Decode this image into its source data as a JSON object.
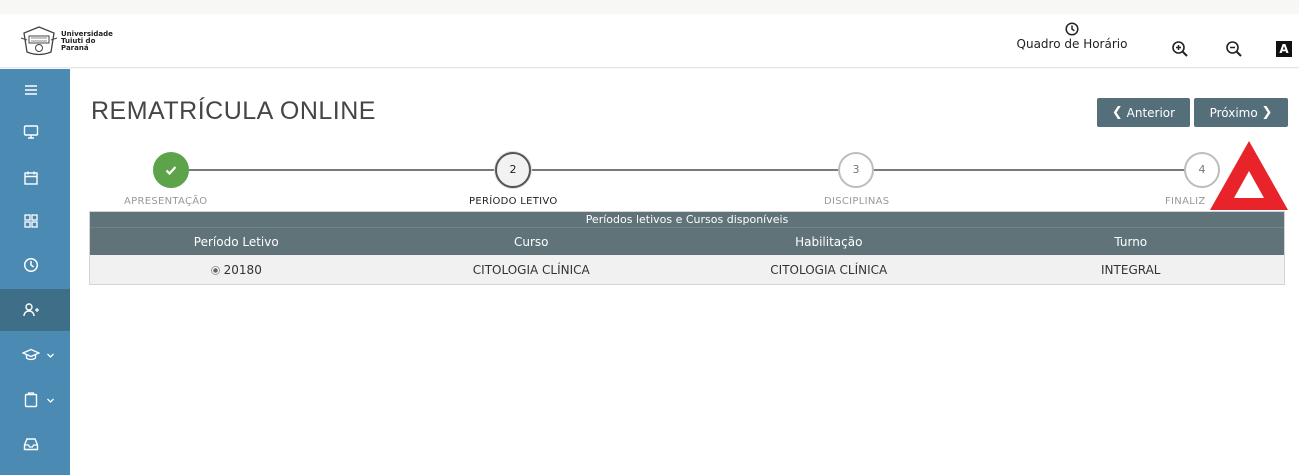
{
  "header": {
    "logo_text": [
      "Universidade",
      "Tuiuti do",
      "Paraná"
    ],
    "horario_label": "Quadro de Horário",
    "contrast_label": "A",
    "icons": [
      "clock-icon",
      "zoom-in-icon",
      "zoom-out-icon",
      "contrast-icon"
    ]
  },
  "sidebar": {
    "items": [
      {
        "name": "menu",
        "icon": "hamburger-icon"
      },
      {
        "name": "monitor",
        "icon": "monitor-icon"
      },
      {
        "name": "calendar",
        "icon": "calendar-icon"
      },
      {
        "name": "dashboard",
        "icon": "grid-icon"
      },
      {
        "name": "history",
        "icon": "clock-icon"
      },
      {
        "name": "rematricula",
        "icon": "add-user-icon",
        "active": true
      },
      {
        "name": "academic",
        "icon": "graduation-cap-icon",
        "has_submenu": true
      },
      {
        "name": "documents",
        "icon": "clipboard-icon",
        "has_submenu": true
      },
      {
        "name": "inbox",
        "icon": "inbox-icon"
      }
    ]
  },
  "main": {
    "title": "REMATRÍCULA ONLINE",
    "prev_label": "Anterior",
    "next_label": "Próximo",
    "steps": [
      {
        "number": "",
        "label": "APRESENTAÇÃO",
        "state": "done"
      },
      {
        "number": "2",
        "label": "PERÍODO LETIVO",
        "state": "current"
      },
      {
        "number": "3",
        "label": "DISCIPLINAS",
        "state": "pending"
      },
      {
        "number": "4",
        "label": "FINALIZ",
        "state": "pending"
      }
    ],
    "table": {
      "caption": "Períodos letivos e Cursos disponíveis",
      "headers": [
        "Período Letivo",
        "Curso",
        "Habilitação",
        "Turno"
      ],
      "rows": [
        {
          "periodo": "20180",
          "curso": "CITOLOGIA CLÍNICA",
          "habilitacao": "CITOLOGIA CLÍNICA",
          "turno": "INTEGRAL"
        }
      ]
    }
  },
  "colors": {
    "sidebar": "#4a8ab3",
    "sidebar_active": "#3f6e88",
    "button": "#546e7a",
    "table_header": "#5f7378",
    "step_done": "#5da34a",
    "arrow": "#e8242a"
  }
}
